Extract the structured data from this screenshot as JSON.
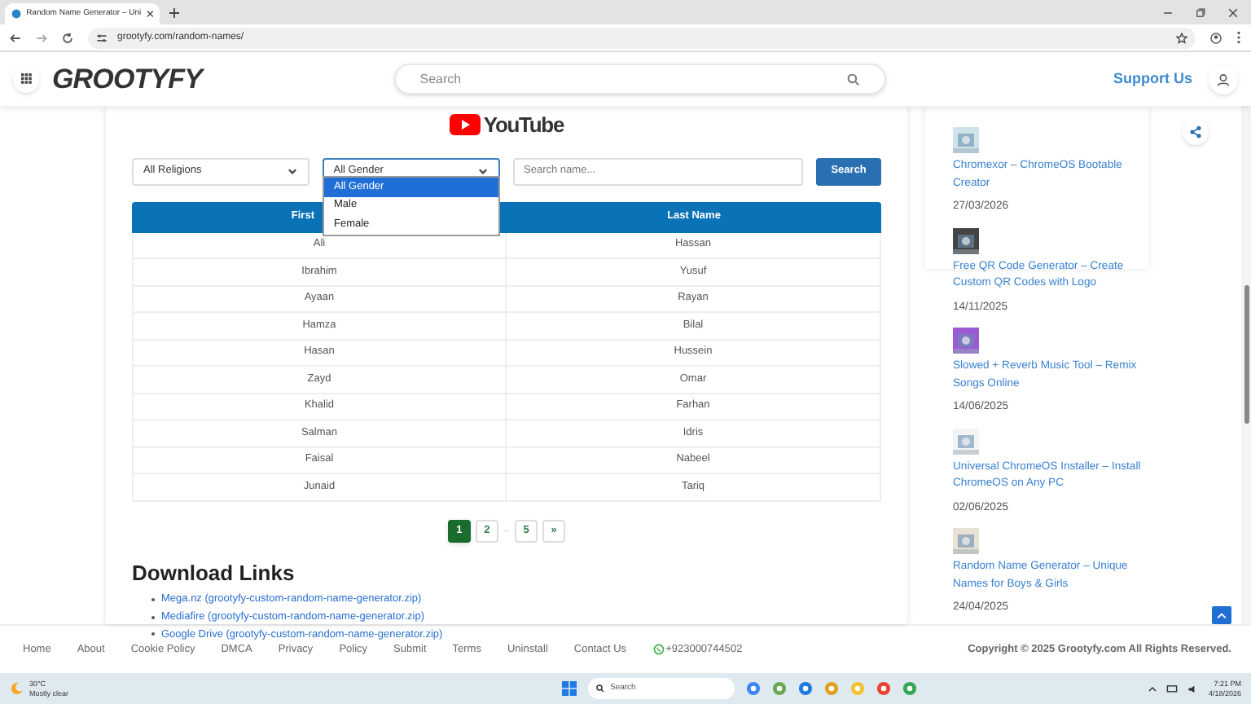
{
  "browser": {
    "tab_title": "Random Name Generator – Uni",
    "url": "grootyfy.com/random-names/"
  },
  "header": {
    "logo": "GROOTYFY",
    "search": {
      "placeholder": "Search"
    },
    "support_link": "Support Us"
  },
  "main": {
    "video_logo": "YouTube",
    "filters": {
      "religion": {
        "value": "All Religions"
      },
      "gender": {
        "value": "All Gender",
        "expanded": true,
        "options": [
          {
            "label": "All Gender",
            "selected": true
          },
          {
            "label": "Male",
            "selected": false
          },
          {
            "label": "Female",
            "selected": false
          }
        ]
      },
      "search": {
        "placeholder": "Search name..."
      },
      "search_button": "Search"
    },
    "table": {
      "columns": [
        "First",
        "Last Name"
      ],
      "rows": [
        [
          "Ali",
          "Hassan"
        ],
        [
          "Ibrahim",
          "Yusuf"
        ],
        [
          "Ayaan",
          "Rayan"
        ],
        [
          "Hamza",
          "Bilal"
        ],
        [
          "Hasan",
          "Hussein"
        ],
        [
          "Zayd",
          "Omar"
        ],
        [
          "Khalid",
          "Farhan"
        ],
        [
          "Salman",
          "Idris"
        ],
        [
          "Faisal",
          "Nabeel"
        ],
        [
          "Junaid",
          "Tariq"
        ]
      ]
    },
    "pagination": [
      {
        "label": "1",
        "kind": "page",
        "selected": true
      },
      {
        "label": "2",
        "kind": "page",
        "selected": false
      },
      {
        "label": "...",
        "kind": "gap"
      },
      {
        "label": "5",
        "kind": "page",
        "selected": false
      },
      {
        "label": "»",
        "kind": "page",
        "selected": false
      }
    ],
    "download_heading": "Download Links",
    "downloads": [
      "Mega.nz (grootyfy-custom-random-name-generator.zip)",
      "Mediafire (grootyfy-custom-random-name-generator.zip)",
      "Google Drive (grootyfy-custom-random-name-generator.zip)"
    ]
  },
  "sidebar": {
    "posts": [
      {
        "title": "Chromexor – ChromeOS Bootable Creator",
        "date": "27/03/2026"
      },
      {
        "title": "Free QR Code Generator – Create Custom QR Codes with Logo",
        "date": "14/11/2025"
      },
      {
        "title": "Slowed + Reverb Music Tool – Remix Songs Online",
        "date": "14/06/2025"
      },
      {
        "title": "Universal ChromeOS Installer – Install ChromeOS on Any PC",
        "date": "02/06/2025"
      },
      {
        "title": "Random Name Generator – Unique Names for Boys & Girls",
        "date": "24/04/2025"
      }
    ]
  },
  "footer": {
    "links": [
      "Home",
      "About",
      "Cookie Policy",
      "DMCA",
      "Privacy",
      "Policy",
      "Submit",
      "Terms",
      "Uninstall",
      "Contact Us"
    ],
    "phone": "+923000744502",
    "copyright": "Copyright © 2025 Grootyfy.com All Rights Reserved."
  },
  "taskbar": {
    "temperature": "30°C",
    "weather": "Mostly clear",
    "search": {
      "placeholder": "Search"
    },
    "time": "7:21 PM",
    "date": "4/18/2026"
  }
}
